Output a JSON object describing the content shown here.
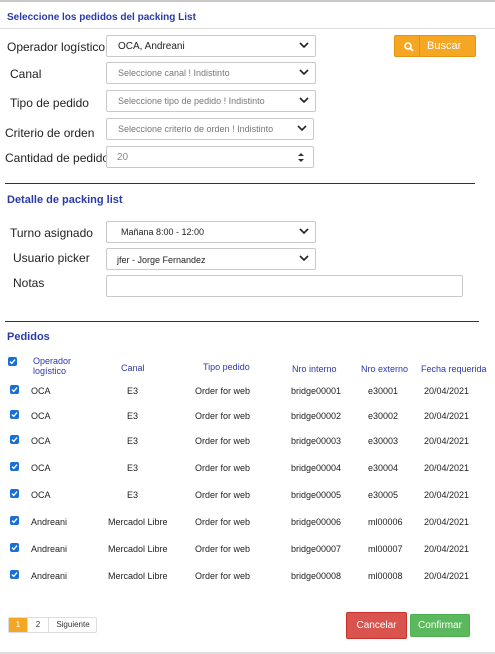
{
  "header": {
    "title": "Seleccione los pedidos del packing List"
  },
  "filters": {
    "operador": {
      "label": "Operador logístico",
      "value": "OCA, Andreani"
    },
    "canal": {
      "label": "Canal",
      "placeholder": "Seleccione canal ! Indistinto"
    },
    "tipo": {
      "label": "Tipo de pedido",
      "placeholder": "Seleccione tipo de pedido ! Indistinto"
    },
    "criterio": {
      "label": "Criterio de orden",
      "placeholder": "Seleccione criterio de orden ! Indistinto"
    },
    "cantidad": {
      "label": "Cantidad de pedidos",
      "value": "20"
    },
    "search_label": "Buscar"
  },
  "detalle": {
    "title": "Detalle de packing list",
    "turno": {
      "label": "Turno asignado",
      "value": "Mañana 8:00 - 12:00"
    },
    "usuario": {
      "label": "Usuario picker",
      "value": "jfer - Jorge Fernandez"
    },
    "notas": {
      "label": "Notas",
      "value": ""
    }
  },
  "pedidos": {
    "title": "Pedidos",
    "columns": [
      "Operador logístico",
      "Canal",
      "Tipo pedido",
      "Nro interno",
      "Nro externo",
      "Fecha requerida"
    ],
    "rows": [
      {
        "operador": "OCA",
        "canal": "E3",
        "tipo": "Order for web",
        "interno": "bridge00001",
        "externo": "e30001",
        "fecha": "20/04/2021"
      },
      {
        "operador": "OCA",
        "canal": "E3",
        "tipo": "Order for web",
        "interno": "bridge00002",
        "externo": "e30002",
        "fecha": "20/04/2021"
      },
      {
        "operador": "OCA",
        "canal": "E3",
        "tipo": "Order for web",
        "interno": "bridge00003",
        "externo": "e30003",
        "fecha": "20/04/2021"
      },
      {
        "operador": "OCA",
        "canal": "E3",
        "tipo": "Order for web",
        "interno": "bridge00004",
        "externo": "e30004",
        "fecha": "20/04/2021"
      },
      {
        "operador": "OCA",
        "canal": "E3",
        "tipo": "Order for web",
        "interno": "bridge00005",
        "externo": "e30005",
        "fecha": "20/04/2021"
      },
      {
        "operador": "Andreani",
        "canal": "Mercadol Libre",
        "tipo": "Order for web",
        "interno": "bridge00006",
        "externo": "ml00006",
        "fecha": "20/04/2021"
      },
      {
        "operador": "Andreani",
        "canal": "Mercadol Libre",
        "tipo": "Order for web",
        "interno": "bridge00007",
        "externo": "ml00007",
        "fecha": "20/04/2021"
      },
      {
        "operador": "Andreani",
        "canal": "Mercadol Libre",
        "tipo": "Order for web",
        "interno": "bridge00008",
        "externo": "ml00008",
        "fecha": "20/04/2021"
      }
    ]
  },
  "pagination": {
    "pages": [
      "1",
      "2"
    ],
    "next": "Siguiente"
  },
  "actions": {
    "cancel": "Cancelar",
    "confirm": "Confirmar"
  },
  "colors": {
    "accent": "#2a3aa8",
    "search": "#f5a623",
    "cancel": "#d9534f",
    "confirm": "#5cb85c",
    "checkbox": "#1a6fd6"
  }
}
